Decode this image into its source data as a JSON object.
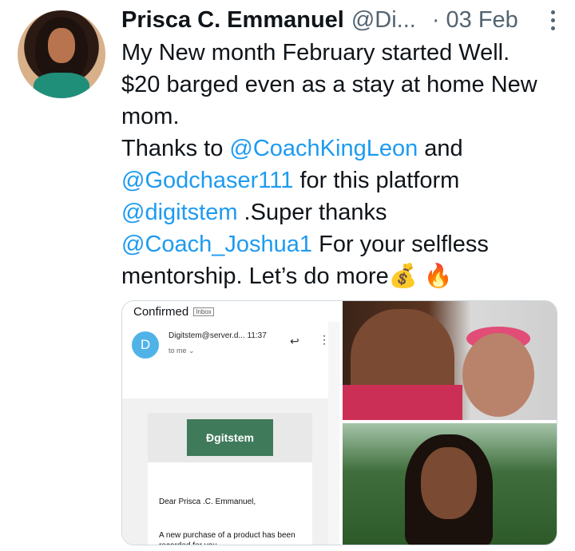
{
  "tweet": {
    "author_name": "Prisca C. Emmanuel",
    "author_handle": "@Di...",
    "separator": "·",
    "date": "03 Feb",
    "lines": {
      "l1": "My New month  February started Well.",
      "l2": "$20 barged even as a stay at home New",
      "l3": "mom.",
      "l4_a": "Thanks to ",
      "l4_mention": "@CoachKingLeon",
      "l4_b": " and",
      "l5_mention": "@Godchaser111",
      "l5_b": " for this platform",
      "l6_mention": "@digitstem",
      "l6_b": " .Super thanks",
      "l7_mention": "@Coach_Joshua1",
      "l7_b": " For your selfless",
      "l8": "mentorship. Let’s do more",
      "emoji_money": "💰",
      "emoji_fire": "🔥"
    }
  },
  "email": {
    "folder_title": "Confirmed",
    "folder_badge": "Inbox",
    "sender_initial": "D",
    "sender": "Digitstem@server.d...",
    "time": "11:37",
    "to": "to me ⌄",
    "logo_text": "Đgitstem",
    "greeting": "Dear Prisca .C. Emmanuel,",
    "purchase_text": "A new purchase of a product has been recorded for you."
  },
  "icons": {
    "reply": "reply-icon",
    "more": "more-vertical-icon"
  },
  "colors": {
    "link": "#1d9bf0",
    "secondary_text": "#536471"
  }
}
